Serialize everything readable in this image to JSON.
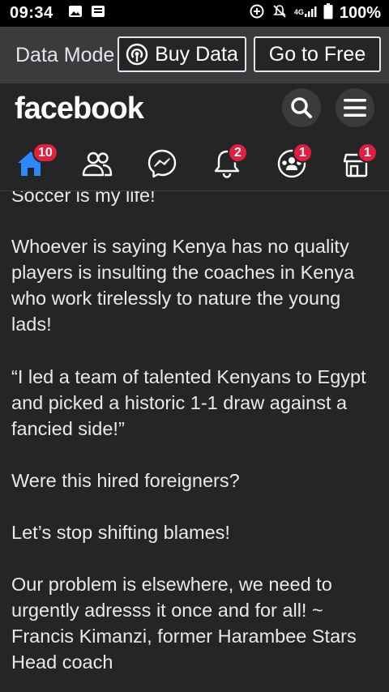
{
  "status_bar": {
    "time": "09:34",
    "battery_percent": "100%",
    "network_label": "4G",
    "icons": [
      "image-icon",
      "message-icon",
      "data-saver-icon",
      "mute-icon",
      "signal-icon",
      "battery-icon"
    ]
  },
  "data_mode": {
    "label": "Data Mode",
    "buy_button": "Buy Data",
    "free_button": "Go to Free"
  },
  "header": {
    "logo": "facebook",
    "icons": [
      "search-icon",
      "menu-icon"
    ]
  },
  "nav": {
    "items": [
      {
        "name": "home",
        "badge": "10",
        "active": true
      },
      {
        "name": "friends",
        "badge": ""
      },
      {
        "name": "messenger",
        "badge": ""
      },
      {
        "name": "notifications",
        "badge": "2"
      },
      {
        "name": "groups",
        "badge": "1"
      },
      {
        "name": "marketplace",
        "badge": "1"
      }
    ]
  },
  "post": {
    "paragraphs": [
      "Soccer is my life!",
      "Whoever is saying Kenya has no quality players is insulting the coaches in Kenya who work tirelessly to nature the young lads!",
      "“I led a team of talented Kenyans to Egypt and picked a historic  1-1 draw against a fancied side!”",
      "Were this hired foreigners?",
      "Let’s stop shifting blames!",
      "Our problem is elsewhere, we need to urgently adresss it once and for all! ~ Francis Kimanzi, former Harambee Stars Head coach"
    ]
  },
  "colors": {
    "background": "#242526",
    "status_bar": "#000000",
    "accent_blue": "#2d88ff",
    "badge_red": "#e41e3f"
  }
}
